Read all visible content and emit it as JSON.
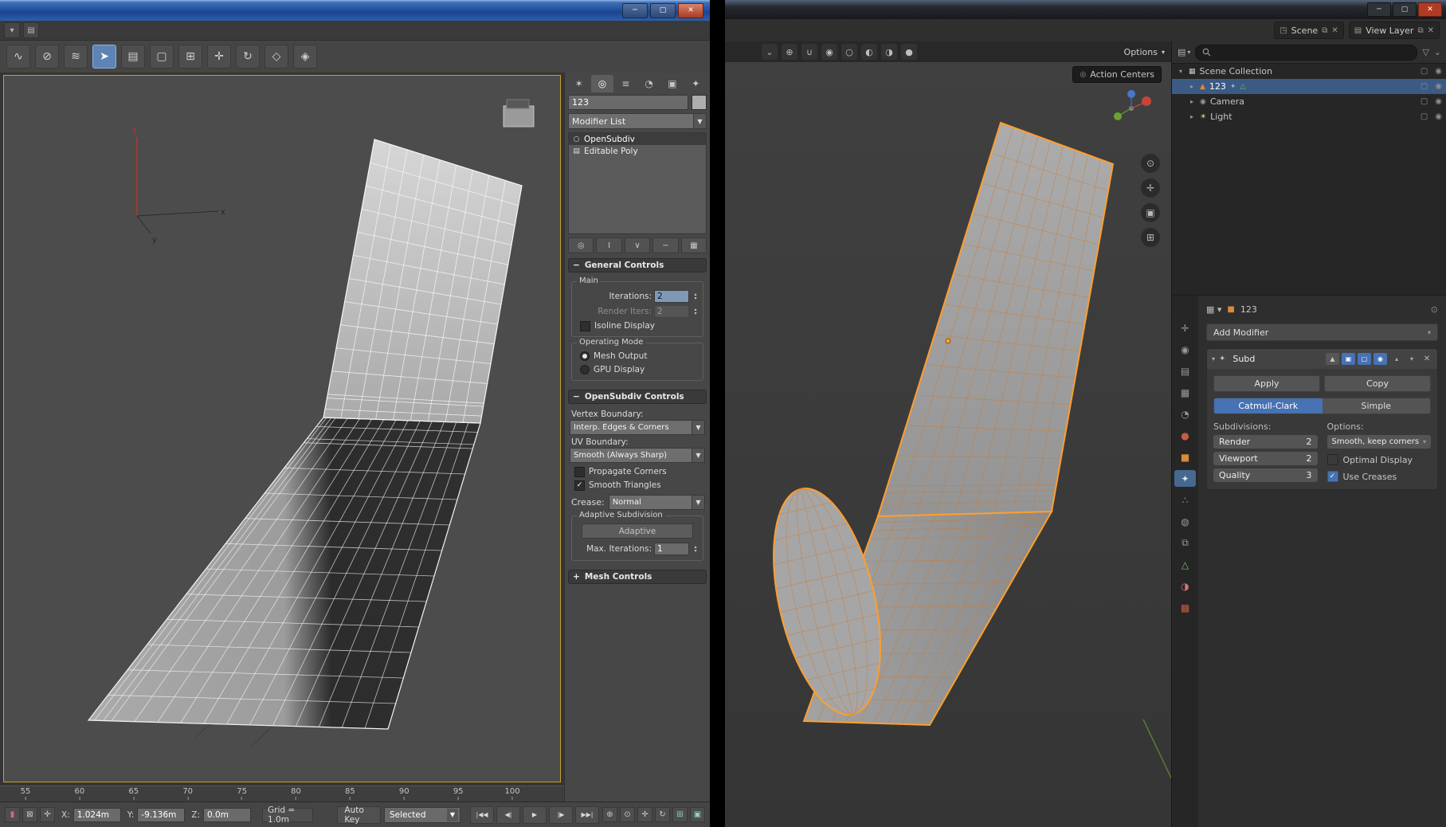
{
  "left_app": {
    "titlebar": {
      "minimize": "─",
      "maximize": "▢",
      "close": "✕"
    },
    "menustrip_icons": [
      {
        "name": "quick-access-icon",
        "glyph": "▾"
      },
      {
        "name": "workspace-selector-icon",
        "glyph": "▤"
      }
    ],
    "toolbar_icons": [
      {
        "name": "select-and-link-icon",
        "glyph": "∿",
        "active": false
      },
      {
        "name": "unlink-selection-icon",
        "glyph": "⊘",
        "active": false
      },
      {
        "name": "bind-to-space-warp-icon",
        "glyph": "≋",
        "active": false
      },
      {
        "name": "select-object-icon",
        "glyph": "➤",
        "active": true
      },
      {
        "name": "select-by-name-icon",
        "glyph": "▤",
        "active": false
      },
      {
        "name": "selection-region-icon",
        "glyph": "▢",
        "active": false
      },
      {
        "name": "window-crossing-icon",
        "glyph": "⊞",
        "active": false
      },
      {
        "name": "select-and-move-icon",
        "glyph": "✛",
        "active": false
      },
      {
        "name": "select-and-rotate-icon",
        "glyph": "↻",
        "active": false
      },
      {
        "name": "select-and-scale-icon",
        "glyph": "◇",
        "active": false
      },
      {
        "name": "snaps-toggle-icon",
        "glyph": "◈",
        "active": false
      }
    ],
    "command_panel": {
      "tabs": [
        {
          "name": "create-tab",
          "glyph": "✶",
          "active": false
        },
        {
          "name": "modify-tab",
          "glyph": "◎",
          "active": true
        },
        {
          "name": "hierarchy-tab",
          "glyph": "≡",
          "active": false
        },
        {
          "name": "motion-tab",
          "glyph": "◔",
          "active": false
        },
        {
          "name": "display-tab",
          "glyph": "▣",
          "active": false
        },
        {
          "name": "utilities-tab",
          "glyph": "✦",
          "active": false
        }
      ],
      "object_name": "123",
      "modifier_list_label": "Modifier List",
      "stack": [
        {
          "label": "OpenSubdiv",
          "icon": "○",
          "selected": true
        },
        {
          "label": "Editable Poly",
          "icon": "▤",
          "selected": false
        }
      ],
      "stack_buttons": [
        {
          "name": "pin-stack-button",
          "glyph": "◎"
        },
        {
          "name": "show-end-result-button",
          "glyph": "I"
        },
        {
          "name": "make-unique-button",
          "glyph": "∨"
        },
        {
          "name": "remove-modifier-button",
          "glyph": "−"
        },
        {
          "name": "configure-modifier-sets-button",
          "glyph": "▦"
        }
      ],
      "general_controls": {
        "title": "General Controls",
        "main_group_label": "Main",
        "iterations_label": "Iterations:",
        "iterations_value": "2",
        "render_iters_label": "Render Iters:",
        "render_iters_value": "2",
        "isoline_display_label": "Isoline Display",
        "operating_mode_label": "Operating Mode",
        "mesh_output_label": "Mesh Output",
        "gpu_display_label": "GPU Display"
      },
      "opensubdiv_controls": {
        "title": "OpenSubdiv Controls",
        "vertex_boundary_label": "Vertex Boundary:",
        "vertex_boundary_value": "Interp. Edges & Corners",
        "uv_boundary_label": "UV Boundary:",
        "uv_boundary_value": "Smooth (Always Sharp)",
        "propagate_corners_label": "Propagate Corners",
        "smooth_triangles_label": "Smooth Triangles",
        "crease_label": "Crease:",
        "crease_value": "Normal",
        "adaptive_group_label": "Adaptive Subdivision",
        "adaptive_button_label": "Adaptive",
        "max_iterations_label": "Max. Iterations:",
        "max_iterations_value": "1"
      },
      "mesh_controls_title": "Mesh Controls"
    },
    "timeline_ticks": [
      "55",
      "60",
      "65",
      "70",
      "75",
      "80",
      "85",
      "90",
      "95",
      "100"
    ],
    "status_bar": {
      "left_icons": [
        {
          "name": "maxscript-mini-listener-icon",
          "glyph": "▮",
          "color": "#d2688a"
        },
        {
          "name": "selection-lock-toggle-icon",
          "glyph": "⊠",
          "color": "#c9c9c9"
        },
        {
          "name": "absolute-offset-toggle-icon",
          "glyph": "✛",
          "color": "#c9c9c9"
        }
      ],
      "x_label": "X:",
      "x_value": "1.024m",
      "y_label": "Y:",
      "y_value": "-9.136m",
      "z_label": "Z:",
      "z_value": "0.0m",
      "grid_label": "Grid = 1.0m",
      "auto_key_label": "Auto Key",
      "selection_set_label": "Selected",
      "playback": [
        {
          "name": "go-to-start-button",
          "glyph": "|◀◀"
        },
        {
          "name": "previous-frame-button",
          "glyph": "◀|"
        },
        {
          "name": "play-button",
          "glyph": "▶"
        },
        {
          "name": "next-frame-button",
          "glyph": "|▶"
        },
        {
          "name": "go-to-end-button",
          "glyph": "▶▶|"
        }
      ],
      "nav_icons": [
        {
          "name": "zoom-extents-icon",
          "glyph": "⊕",
          "color": "#c9c9c9"
        },
        {
          "name": "zoom-icon",
          "glyph": "⊙",
          "color": "#c9c9c9"
        },
        {
          "name": "pan-view-icon",
          "glyph": "✛",
          "color": "#c9c9c9"
        },
        {
          "name": "orbit-view-icon",
          "glyph": "↻",
          "color": "#c9c9c9"
        },
        {
          "name": "maximize-viewport-icon",
          "glyph": "⊞",
          "color": "#8fd0b8"
        },
        {
          "name": "field-of-view-icon",
          "glyph": "▣",
          "color": "#8fd0b8"
        }
      ]
    },
    "viewport_axis": {
      "x": "x",
      "y": "y",
      "z": "z"
    }
  },
  "right_app": {
    "titlebar": {
      "minimize": "─",
      "maximize": "▢",
      "close": "✕"
    },
    "topbar": {
      "scene_label": "Scene",
      "view_layer_label": "View Layer"
    },
    "viewport_header": {
      "icons": [
        {
          "name": "object-type-visibility-icon",
          "glyph": "⌄"
        },
        {
          "name": "transform-orientation-icon",
          "glyph": "⊕"
        },
        {
          "name": "snap-magnet-icon",
          "glyph": "∪"
        },
        {
          "name": "proportional-edit-icon",
          "glyph": "◉"
        },
        {
          "name": "wireframe-shading-icon",
          "glyph": "○"
        },
        {
          "name": "solid-shading-icon",
          "glyph": "◐"
        },
        {
          "name": "material-shading-icon",
          "glyph": "◑"
        },
        {
          "name": "rendered-shading-icon",
          "glyph": "●"
        }
      ],
      "options_label": "Options",
      "action_centers_label": "Action Centers"
    },
    "nav_gizmos": [
      {
        "name": "zoom-gizmo-icon",
        "glyph": "⊙"
      },
      {
        "name": "pan-gizmo-icon",
        "glyph": "✛"
      },
      {
        "name": "camera-view-gizmo-icon",
        "glyph": "▣"
      },
      {
        "name": "orthographic-toggle-gizmo-icon",
        "glyph": "⊞"
      }
    ],
    "outliner": {
      "collection": {
        "label": "Scene Collection",
        "icon": "▦",
        "icon_color": "#c8c8c8"
      },
      "items": [
        {
          "label": "123",
          "icon": "▲",
          "icon_color": "#e0883c",
          "selected": true,
          "extras": [
            {
              "name": "modifier-wrench-icon",
              "glyph": "✦",
              "color": "#8fb3d9"
            },
            {
              "name": "mesh-data-icon",
              "glyph": "△",
              "color": "#6fbf6f"
            }
          ]
        },
        {
          "label": "Camera",
          "icon": "◉",
          "icon_color": "#9a9a9a",
          "selected": false,
          "extras": []
        },
        {
          "label": "Light",
          "icon": "☀",
          "icon_color": "#e6d78f",
          "selected": false,
          "extras": []
        }
      ],
      "row_right_icons": [
        {
          "name": "disable-in-viewport-icon",
          "glyph": "▢"
        },
        {
          "name": "disable-in-render-icon",
          "glyph": "◉"
        }
      ]
    },
    "properties": {
      "breadcrumb_object": "123",
      "nav_icons": [
        {
          "name": "tool-tab-icon",
          "glyph": "✛",
          "color": "#9a9a9a",
          "active": false
        },
        {
          "name": "render-tab-icon",
          "glyph": "◉",
          "color": "#9a9a9a",
          "active": false
        },
        {
          "name": "output-tab-icon",
          "glyph": "▤",
          "color": "#9a9a9a",
          "active": false
        },
        {
          "name": "view-layer-tab-icon",
          "glyph": "▦",
          "color": "#9a9a9a",
          "active": false
        },
        {
          "name": "scene-tab-icon",
          "glyph": "◔",
          "color": "#9a9a9a",
          "active": false
        },
        {
          "name": "world-tab-icon",
          "glyph": "●",
          "color": "#c65b4a",
          "active": false
        },
        {
          "name": "object-tab-icon",
          "glyph": "■",
          "color": "#d98a3a",
          "active": false
        },
        {
          "name": "modifiers-tab-icon",
          "glyph": "✦",
          "color": "#d8e6f5",
          "active": true
        },
        {
          "name": "particles-tab-icon",
          "glyph": "∴",
          "color": "#9a9a9a",
          "active": false
        },
        {
          "name": "physics-tab-icon",
          "glyph": "◍",
          "color": "#9a9a9a",
          "active": false
        },
        {
          "name": "constraints-tab-icon",
          "glyph": "⧉",
          "color": "#9a9a9a",
          "active": false
        },
        {
          "name": "object-data-tab-icon",
          "glyph": "△",
          "color": "#6fbf6f",
          "active": false
        },
        {
          "name": "material-tab-icon",
          "glyph": "◑",
          "color": "#d1736f",
          "active": false
        },
        {
          "name": "texture-tab-icon",
          "glyph": "▩",
          "color": "#c65b4a",
          "active": false
        }
      ],
      "add_modifier_label": "Add Modifier",
      "modifier": {
        "name": "Subd",
        "toggles": [
          {
            "name": "on-cage-toggle",
            "glyph": "▲",
            "on": false
          },
          {
            "name": "edit-mode-toggle",
            "glyph": "▣",
            "on": true
          },
          {
            "name": "realtime-toggle",
            "glyph": "▢",
            "on": true
          },
          {
            "name": "render-toggle",
            "glyph": "◉",
            "on": true
          }
        ],
        "apply_label": "Apply",
        "copy_label": "Copy",
        "catmull_clark_label": "Catmull-Clark",
        "simple_label": "Simple",
        "subdivisions_label": "Subdivisions:",
        "render_label": "Render",
        "render_value": "2",
        "viewport_label": "Viewport",
        "viewport_value": "2",
        "quality_label": "Quality",
        "quality_value": "3",
        "options_label": "Options:",
        "boundary_smoothing_value": "Smooth, keep corners",
        "optimal_display_label": "Optimal Display",
        "use_creases_label": "Use Creases"
      }
    }
  }
}
